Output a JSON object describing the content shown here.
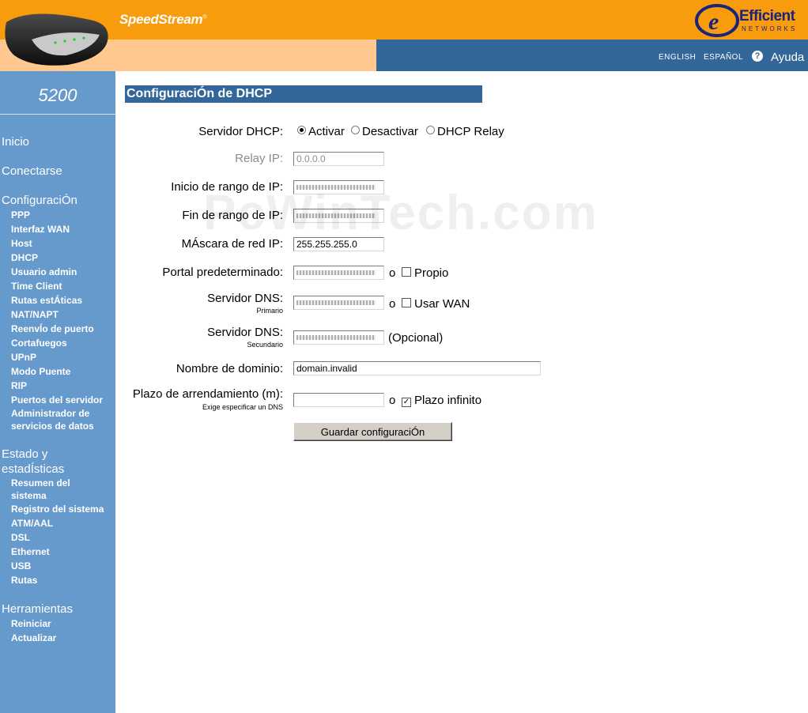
{
  "header": {
    "brand": "SpeedStream",
    "brand_mark": "®",
    "logo_word": "Efficient",
    "logo_sub": "NETWORKS",
    "lang_en": "ENGLISH",
    "lang_es": "ESPAÑOL",
    "help_label": "Ayuda",
    "help_icon": "question-circle-icon"
  },
  "sidebar": {
    "model": "5200",
    "sections": [
      {
        "label": "Inicio"
      },
      {
        "label": "Conectarse"
      },
      {
        "label": "ConfiguraciÓn",
        "items": [
          "PPP",
          "Interfaz WAN",
          "Host",
          "DHCP",
          "Usuario admin",
          "Time Client",
          "Rutas estÁticas",
          "NAT/NAPT",
          "ReenvÍo de puerto",
          "Cortafuegos",
          "UPnP",
          "Modo Puente",
          "RIP",
          "Puertos del servidor",
          "Administrador de servicios de datos"
        ]
      },
      {
        "label": "Estado y estadÍsticas",
        "items": [
          "Resumen del sistema",
          "Registro del sistema",
          "ATM/AAL",
          "DSL",
          "Ethernet",
          "USB",
          "Rutas"
        ]
      },
      {
        "label": "Herramientas",
        "items": [
          "Reiniciar",
          "Actualizar"
        ]
      }
    ]
  },
  "main": {
    "title": "ConfiguraciÓn de DHCP",
    "dhcp_server": {
      "label": "Servidor DHCP:",
      "options": [
        "Activar",
        "Desactivar",
        "DHCP Relay"
      ],
      "selected": "Activar"
    },
    "relay_ip": {
      "label": "Relay IP:",
      "value": "0.0.0.0"
    },
    "range_start": {
      "label": "Inicio de rango de IP:",
      "value": ""
    },
    "range_end": {
      "label": "Fin de rango de IP:",
      "value": ""
    },
    "netmask": {
      "label": "MÁscara de red IP:",
      "value": "255.255.255.0"
    },
    "gateway": {
      "label": "Portal predeterminado:",
      "value": "",
      "or": "o",
      "checkbox_label": "Propio",
      "checked": false
    },
    "dns_primary": {
      "label": "Servidor DNS:",
      "hint": "Primario",
      "value": "",
      "or": "o",
      "checkbox_label": "Usar WAN",
      "checked": false
    },
    "dns_secondary": {
      "label": "Servidor DNS:",
      "hint": "Secundario",
      "value": "",
      "note": "(Opcional)"
    },
    "domain": {
      "label": "Nombre de dominio:",
      "value": "domain.invalid"
    },
    "lease": {
      "label": "Plazo de arrendamiento (m):",
      "hint": "Exige especificar un DNS",
      "value": "",
      "or": "o",
      "checkbox_label": "Plazo infinito",
      "checked": true
    },
    "save_label": "Guardar configuraciÓn"
  },
  "watermark": "PcWinTech.com"
}
